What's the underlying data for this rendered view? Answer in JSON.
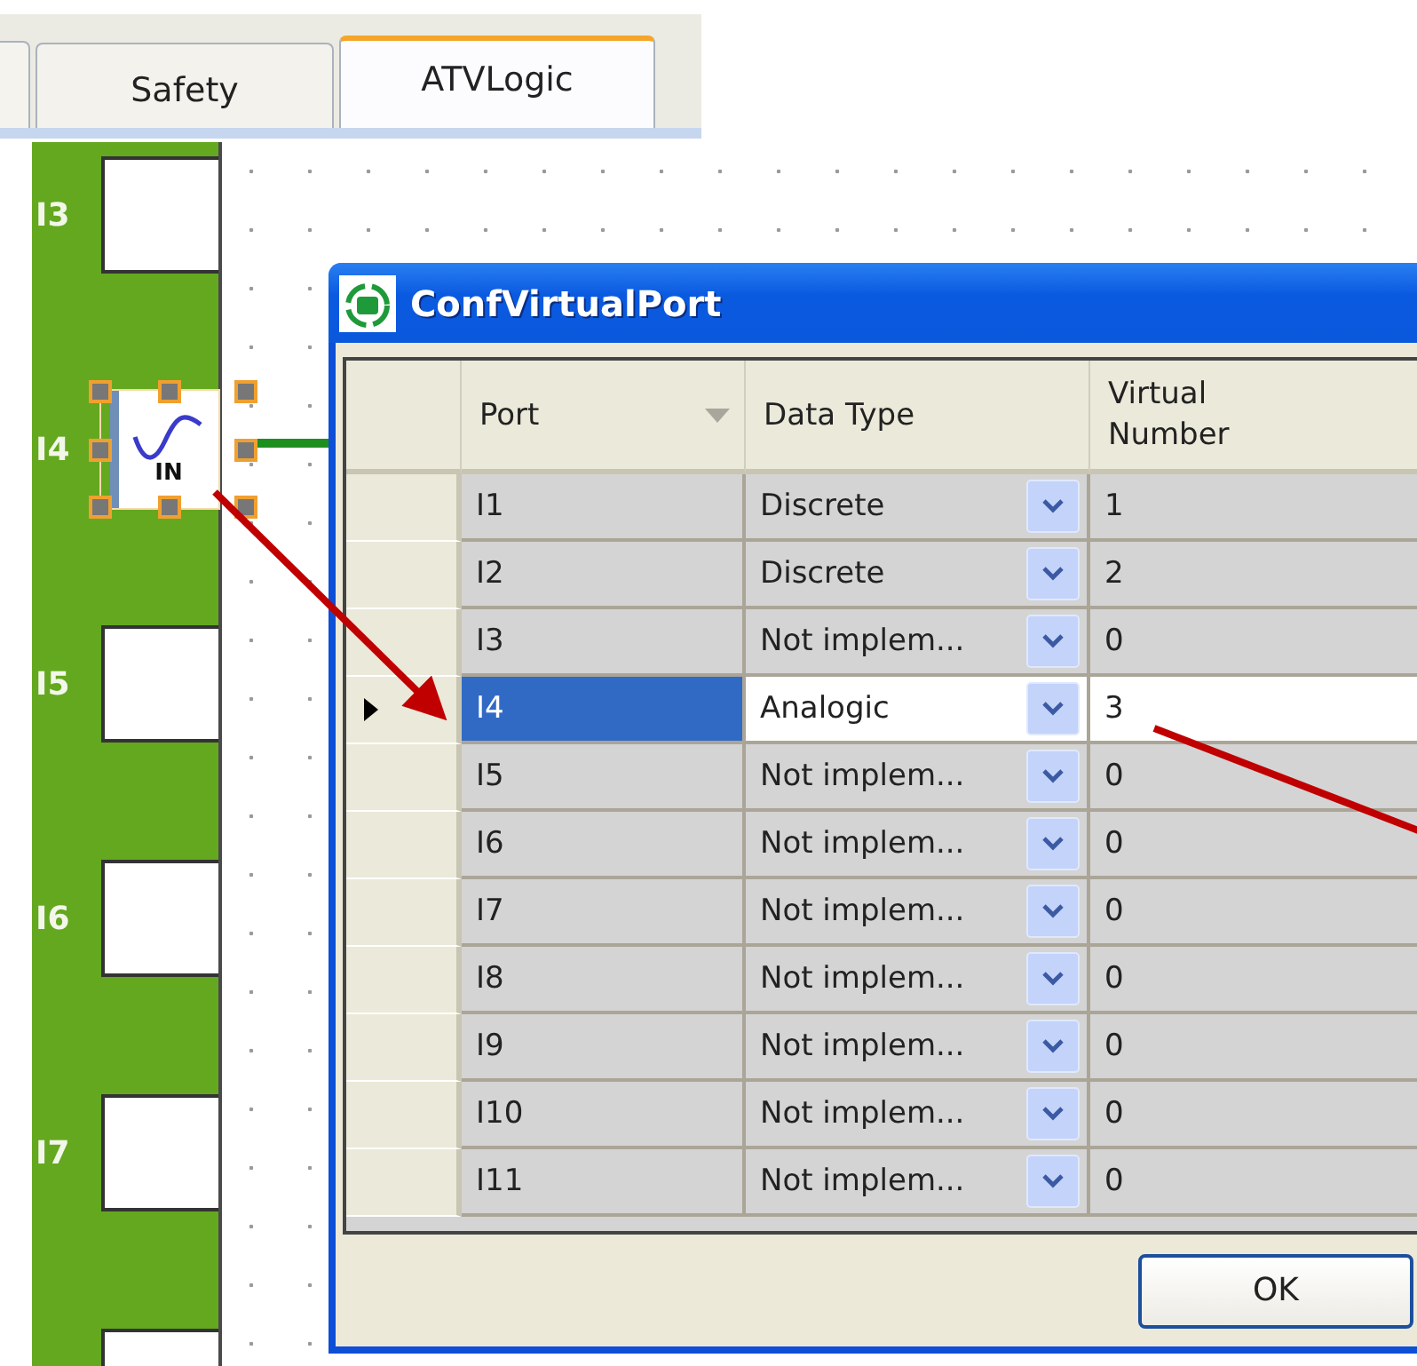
{
  "tabs": [
    {
      "label": "Safety",
      "selected": false
    },
    {
      "label": "ATVLogic",
      "selected": true
    }
  ],
  "ports": [
    {
      "label": "I3",
      "selected": false
    },
    {
      "label": "I4",
      "selected": true,
      "block": "IN"
    },
    {
      "label": "I5",
      "selected": false
    },
    {
      "label": "I6",
      "selected": false
    },
    {
      "label": "I7",
      "selected": false
    },
    {
      "selected": false
    }
  ],
  "dialog": {
    "title": "ConfVirtualPort",
    "columns": [
      "Port",
      "Data Type",
      "Virtual Number"
    ],
    "rows": [
      {
        "port": "I1",
        "data_type": "Discrete",
        "virtual_number": "1",
        "selected": false
      },
      {
        "port": "I2",
        "data_type": "Discrete",
        "virtual_number": "2",
        "selected": false
      },
      {
        "port": "I3",
        "data_type": "Not implem...",
        "virtual_number": "0",
        "selected": false
      },
      {
        "port": "I4",
        "data_type": "Analogic",
        "virtual_number": "3",
        "selected": true
      },
      {
        "port": "I5",
        "data_type": "Not implem...",
        "virtual_number": "0",
        "selected": false
      },
      {
        "port": "I6",
        "data_type": "Not implem...",
        "virtual_number": "0",
        "selected": false
      },
      {
        "port": "I7",
        "data_type": "Not implem...",
        "virtual_number": "0",
        "selected": false
      },
      {
        "port": "I8",
        "data_type": "Not implem...",
        "virtual_number": "0",
        "selected": false
      },
      {
        "port": "I9",
        "data_type": "Not implem...",
        "virtual_number": "0",
        "selected": false
      },
      {
        "port": "I10",
        "data_type": "Not implem...",
        "virtual_number": "0",
        "selected": false
      },
      {
        "port": "I11",
        "data_type": "Not implem...",
        "virtual_number": "0",
        "selected": false
      }
    ],
    "buttons": [
      "OK"
    ]
  }
}
